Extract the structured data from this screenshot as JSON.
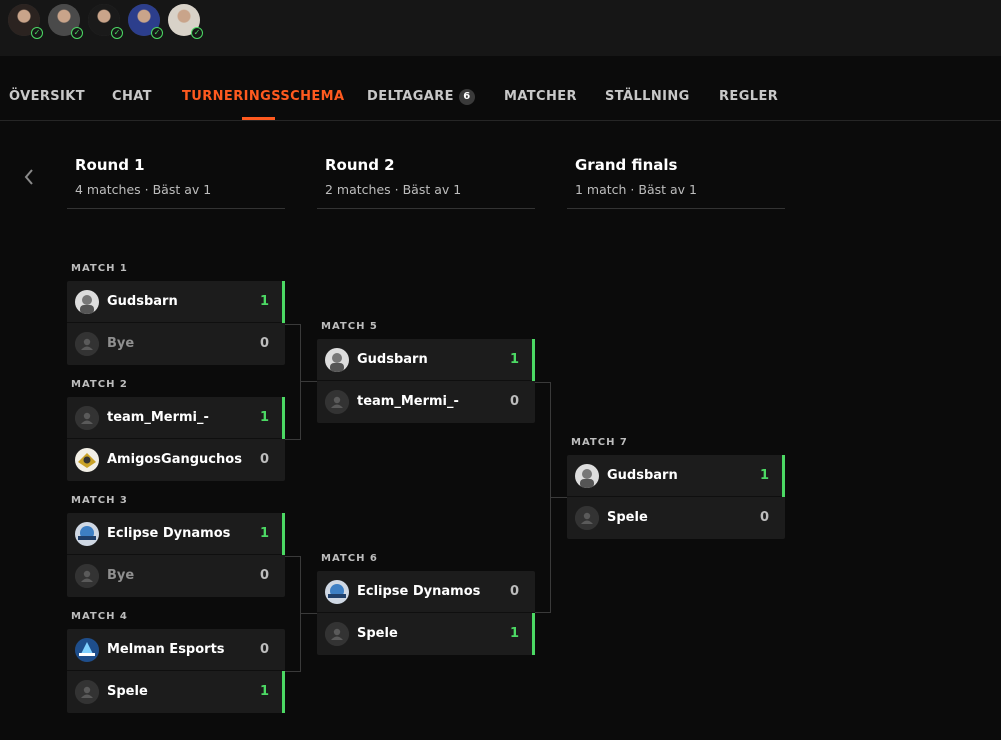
{
  "participants_bar": {
    "avatars": [
      {
        "name": "avatar-1",
        "color": "#2b2320",
        "status": "ready"
      },
      {
        "name": "avatar-2",
        "color": "#4a4a4a",
        "status": "ready"
      },
      {
        "name": "avatar-3",
        "color": "#1a1a1a",
        "status": "ready"
      },
      {
        "name": "avatar-4",
        "color": "#2c3e8c",
        "status": "ready"
      },
      {
        "name": "avatar-5",
        "color": "#d8d2c8",
        "status": "ready"
      }
    ]
  },
  "tabs": [
    {
      "label": "ÖVERSIKT"
    },
    {
      "label": "CHAT"
    },
    {
      "label": "TURNERINGSSCHEMA",
      "active": true
    },
    {
      "label": "DELTAGARE",
      "badge": "6"
    },
    {
      "label": "MATCHER"
    },
    {
      "label": "STÄLLNING"
    },
    {
      "label": "REGLER"
    }
  ],
  "rounds": [
    {
      "title": "Round 1",
      "subtitle": "4 matches · Bäst av 1"
    },
    {
      "title": "Round 2",
      "subtitle": "2 matches · Bäst av 1"
    },
    {
      "title": "Grand finals",
      "subtitle": "1 match · Bäst av 1"
    }
  ],
  "matches": [
    {
      "label": "MATCH 1",
      "teams": [
        {
          "name": "Gudsbarn",
          "score": "1",
          "win": true,
          "logo": "photo"
        },
        {
          "name": "Bye",
          "score": "0",
          "win": false,
          "logo": "placeholder",
          "dim": true
        }
      ]
    },
    {
      "label": "MATCH 2",
      "teams": [
        {
          "name": "team_Mermi_-",
          "score": "1",
          "win": true,
          "logo": "placeholder"
        },
        {
          "name": "AmigosGanguchos",
          "score": "0",
          "win": false,
          "logo": "emblem"
        }
      ]
    },
    {
      "label": "MATCH 3",
      "teams": [
        {
          "name": "Eclipse Dynamos",
          "score": "1",
          "win": true,
          "logo": "dynamos"
        },
        {
          "name": "Bye",
          "score": "0",
          "win": false,
          "logo": "placeholder",
          "dim": true
        }
      ]
    },
    {
      "label": "MATCH 4",
      "teams": [
        {
          "name": "Melman Esports",
          "score": "0",
          "win": false,
          "logo": "melman"
        },
        {
          "name": "Spele",
          "score": "1",
          "win": true,
          "logo": "placeholder"
        }
      ]
    },
    {
      "label": "MATCH 5",
      "teams": [
        {
          "name": "Gudsbarn",
          "score": "1",
          "win": true,
          "logo": "photo"
        },
        {
          "name": "team_Mermi_-",
          "score": "0",
          "win": false,
          "logo": "placeholder"
        }
      ]
    },
    {
      "label": "MATCH 6",
      "teams": [
        {
          "name": "Eclipse Dynamos",
          "score": "0",
          "win": false,
          "logo": "dynamos"
        },
        {
          "name": "Spele",
          "score": "1",
          "win": true,
          "logo": "placeholder"
        }
      ]
    },
    {
      "label": "MATCH 7",
      "teams": [
        {
          "name": "Gudsbarn",
          "score": "1",
          "win": true,
          "logo": "photo"
        },
        {
          "name": "Spele",
          "score": "0",
          "win": false,
          "logo": "placeholder"
        }
      ]
    }
  ],
  "colors": {
    "accent": "#ff5a1f",
    "win": "#4cd964"
  }
}
